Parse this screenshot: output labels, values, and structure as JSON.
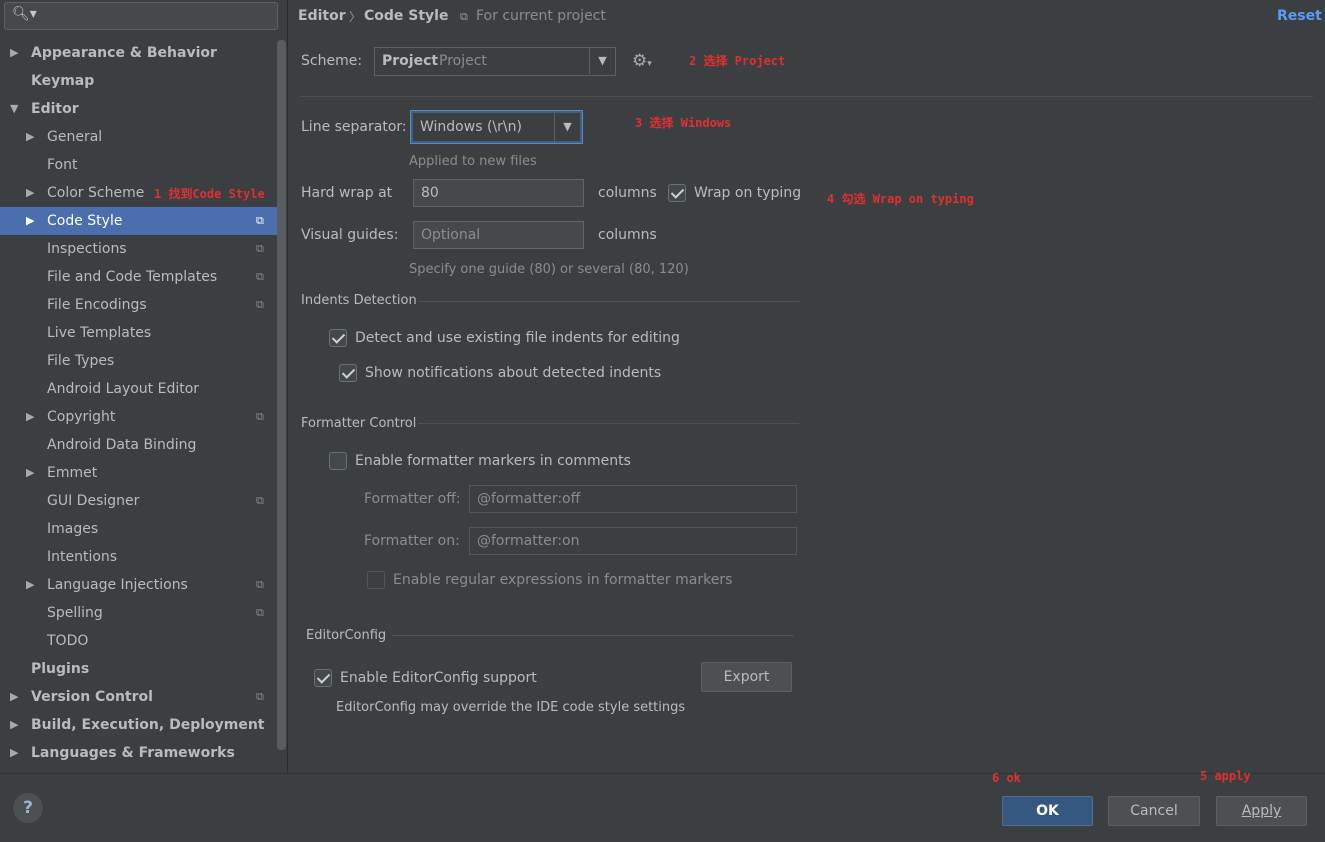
{
  "search": {
    "placeholder": ""
  },
  "sidebar": {
    "items": [
      {
        "label": "Appearance & Behavior",
        "arrow": "▶"
      },
      {
        "label": "Keymap",
        "arrow": ""
      },
      {
        "label": "Editor",
        "arrow": "▼"
      },
      {
        "label": "General",
        "arrow": "▶"
      },
      {
        "label": "Font",
        "arrow": ""
      },
      {
        "label": "Color Scheme",
        "arrow": "▶"
      },
      {
        "label": "Code Style",
        "arrow": "▶"
      },
      {
        "label": "Inspections",
        "arrow": ""
      },
      {
        "label": "File and Code Templates",
        "arrow": ""
      },
      {
        "label": "File Encodings",
        "arrow": ""
      },
      {
        "label": "Live Templates",
        "arrow": ""
      },
      {
        "label": "File Types",
        "arrow": ""
      },
      {
        "label": "Android Layout Editor",
        "arrow": ""
      },
      {
        "label": "Copyright",
        "arrow": "▶"
      },
      {
        "label": "Android Data Binding",
        "arrow": ""
      },
      {
        "label": "Emmet",
        "arrow": "▶"
      },
      {
        "label": "GUI Designer",
        "arrow": ""
      },
      {
        "label": "Images",
        "arrow": ""
      },
      {
        "label": "Intentions",
        "arrow": ""
      },
      {
        "label": "Language Injections",
        "arrow": "▶"
      },
      {
        "label": "Spelling",
        "arrow": ""
      },
      {
        "label": "TODO",
        "arrow": ""
      },
      {
        "label": "Plugins",
        "arrow": ""
      },
      {
        "label": "Version Control",
        "arrow": "▶"
      },
      {
        "label": "Build, Execution, Deployment",
        "arrow": "▶"
      },
      {
        "label": "Languages & Frameworks",
        "arrow": "▶"
      }
    ],
    "selected": "Code Style",
    "project_icon": "copy-icon"
  },
  "header": {
    "crumb1": "Editor",
    "separator": "〉",
    "crumb2": "Code Style",
    "scope_icon": "project-icon",
    "scope": "For current project",
    "reset": "Reset"
  },
  "scheme": {
    "label": "Scheme:",
    "value_bold": "Project",
    "value": "Project",
    "gear_icon": "gear-icon"
  },
  "line_separator": {
    "label": "Line separator:",
    "value": "Windows (\\r\\n)",
    "hint": "Applied to new files"
  },
  "hard_wrap": {
    "label": "Hard wrap at",
    "value": "80",
    "unit": "columns",
    "wrap_on_typing": "Wrap on typing"
  },
  "visual_guides": {
    "label": "Visual guides:",
    "placeholder": "Optional",
    "unit": "columns",
    "hint": "Specify one guide (80) or several (80, 120)"
  },
  "indents": {
    "title": "Indents Detection",
    "detect": "Detect and use existing file indents for editing",
    "notify": "Show notifications about detected indents"
  },
  "formatter": {
    "title": "Formatter Control",
    "enable": "Enable formatter markers in comments",
    "off_label": "Formatter off:",
    "off_value": "@formatter:off",
    "on_label": "Formatter on:",
    "on_value": "@formatter:on",
    "regex": "Enable regular expressions in formatter markers"
  },
  "editorconfig": {
    "title": "EditorConfig",
    "enable": "Enable EditorConfig support",
    "export": "Export",
    "note": "EditorConfig may override the IDE code style settings"
  },
  "annotations": {
    "a1": "1 找到Code Style",
    "a2": "2 选择 Project",
    "a3": "3 选择 Windows",
    "a4": "4 勾选 Wrap on typing",
    "a5": "5 apply",
    "a6": "6 ok"
  },
  "footer": {
    "help": "?",
    "ok": "OK",
    "cancel": "Cancel",
    "apply": "Apply"
  },
  "colors": {
    "background": "#3c3f41",
    "selection": "#4b6eaf",
    "link": "#589df6",
    "annotation": "#e03030"
  }
}
